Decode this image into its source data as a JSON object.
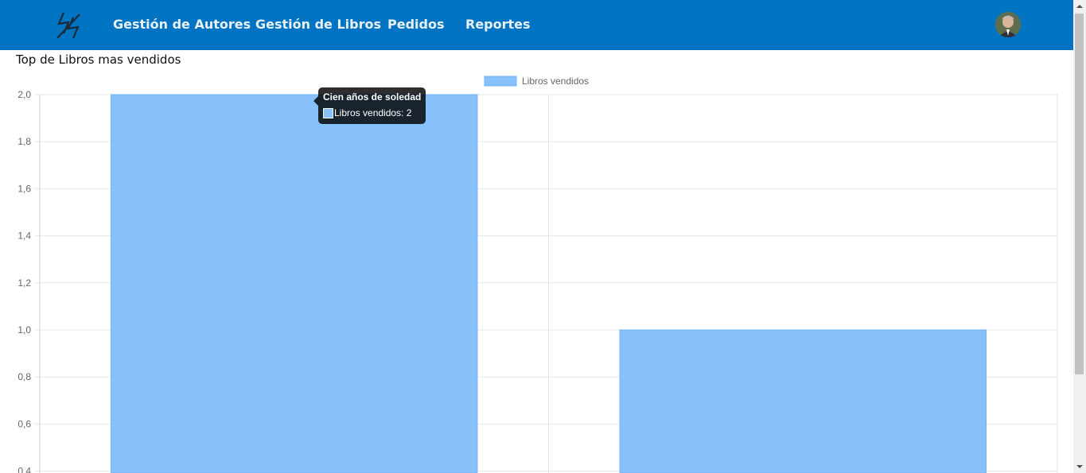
{
  "nav": {
    "items": [
      {
        "label": "Gestión de Autores"
      },
      {
        "label": "Gestión de Libros"
      },
      {
        "label": "Pedidos"
      },
      {
        "label": "Reportes"
      }
    ]
  },
  "page": {
    "title": "Top de Libros mas vendidos"
  },
  "tooltip": {
    "title": "Cien años de soledad",
    "body": "Libros vendidos: 2"
  },
  "colors": {
    "navbar": "#0074c2",
    "bar": "#87c1fc",
    "bar_border": "#74b3f5"
  },
  "chart_data": {
    "type": "bar",
    "categories": [
      "Cien años de soledad",
      ""
    ],
    "series": [
      {
        "name": "Libros vendidos",
        "values": [
          2,
          1
        ]
      }
    ],
    "y_ticks": [
      "2,0",
      "1,8",
      "1,6",
      "1,4",
      "1,2",
      "1,0",
      "0,8",
      "0,6",
      "0,4"
    ],
    "ylim": [
      0,
      2
    ],
    "grid": true,
    "legend": "top-center"
  }
}
